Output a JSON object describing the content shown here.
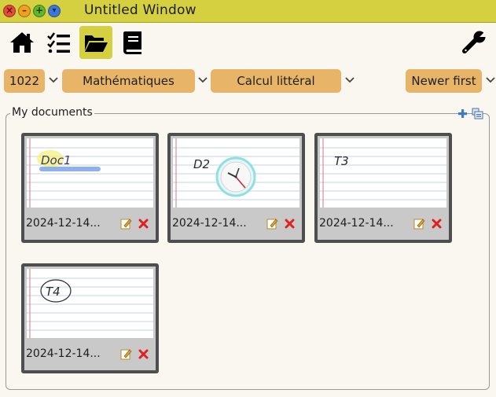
{
  "window": {
    "title": "Untitled Window",
    "buttons": {
      "close": "×",
      "minimize": "–",
      "maximize": "+",
      "menu": "▾"
    }
  },
  "toolbar": {
    "items": [
      {
        "name": "home",
        "icon": "home-icon"
      },
      {
        "name": "tasks",
        "icon": "checklist-icon"
      },
      {
        "name": "documents",
        "icon": "folder-open-icon",
        "active": true
      },
      {
        "name": "book",
        "icon": "book-icon"
      },
      {
        "name": "settings",
        "icon": "wrench-icon"
      }
    ],
    "active_color": "#d4d040"
  },
  "filters": {
    "id": "1022",
    "subject": "Mathématiques",
    "topic": "Calcul littéral",
    "sort": "Newer first",
    "pill_color": "#e8b468"
  },
  "documents": {
    "title": "My documents",
    "items": [
      {
        "label": "2024-12-14...",
        "thumbnail_text": "Doc1"
      },
      {
        "label": "2024-12-14...",
        "thumbnail_text": "D2"
      },
      {
        "label": "2024-12-14...",
        "thumbnail_text": "T3"
      },
      {
        "label": "2024-12-14...",
        "thumbnail_text": "T4"
      }
    ]
  },
  "colors": {
    "titlebar": "#d4d040",
    "background": "#faf6f0",
    "card_border": "#4e4e4e"
  }
}
